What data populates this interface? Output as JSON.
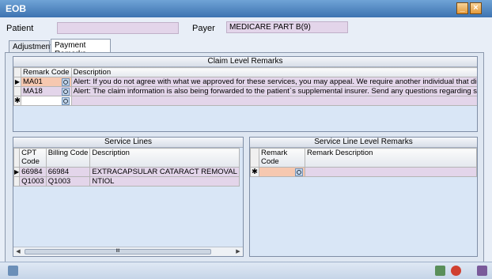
{
  "window": {
    "title": "EOB",
    "minimize_icon": "minimize-icon",
    "close_icon": "close-icon"
  },
  "header": {
    "patient_label": "Patient",
    "patient_value": "",
    "payer_label": "Payer",
    "payer_value": "MEDICARE PART B(9)"
  },
  "tabs": [
    {
      "label": "Adjustments"
    },
    {
      "label": "Payment Remarks"
    }
  ],
  "claim_remarks": {
    "caption": "Claim Level Remarks",
    "columns": [
      "Remark Code",
      "Description"
    ],
    "rows": [
      {
        "code": "MA01",
        "description": "Alert: If you do not agree with what we approved for these services, you may appeal. We require another individual that did not pro"
      },
      {
        "code": "MA18",
        "description": "Alert: The claim information is also being forwarded to the patient`s supplemental insurer. Send any questions regarding suppleme"
      }
    ]
  },
  "service_lines": {
    "caption": "Service Lines",
    "columns": [
      "CPT Code",
      "Billing Code",
      "Description"
    ],
    "rows": [
      {
        "cpt": "66984",
        "billing": "66984",
        "description": "EXTRACAPSULAR CATARACT REMOVAL"
      },
      {
        "cpt": "Q1003",
        "billing": "Q1003",
        "description": "NTIOL"
      }
    ],
    "scroll_thumb": "III"
  },
  "service_line_remarks": {
    "caption": "Service Line Level Remarks",
    "columns": [
      "Remark Code",
      "Remark Description"
    ]
  },
  "row_markers": {
    "current": "▶",
    "new": "✱"
  },
  "colors": {
    "title_bar": "#4a80c0",
    "field_bg": "#e3d5ea",
    "panel_bg": "#d9e6f6"
  }
}
